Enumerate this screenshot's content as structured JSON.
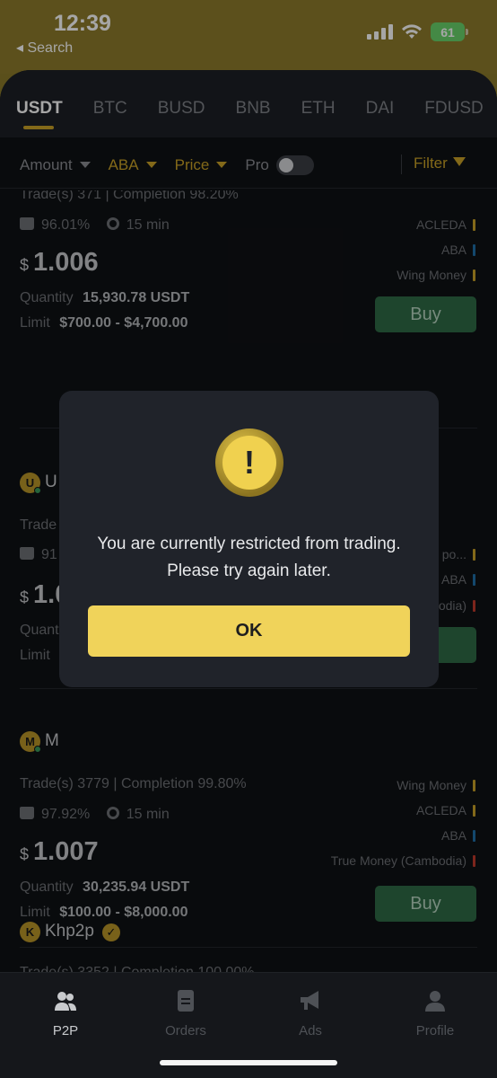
{
  "status_bar": {
    "time": "12:39",
    "back_label": "◂ Search",
    "battery": "61"
  },
  "tabs": [
    "USDT",
    "BTC",
    "BUSD",
    "BNB",
    "ETH",
    "DAI",
    "FDUSD"
  ],
  "filters": {
    "amount": "Amount",
    "bank": "ABA",
    "price": "Price",
    "pro": "Pro",
    "filter": "Filter"
  },
  "cards": [
    {
      "stats": "Trade(s) 371 | Completion 98.20%",
      "positive_rate": "96.01%",
      "time_limit": "15 min",
      "currency": "$",
      "price": "1.006",
      "quantity_label": "Quantity",
      "quantity": "15,930.78 USDT",
      "limit_label": "Limit",
      "limit": "$700.00 - $4,700.00",
      "payments": [
        {
          "name": "ACLEDA",
          "color": "#c9a227"
        },
        {
          "name": "ABA",
          "color": "#1e6fa8"
        },
        {
          "name": "Wing Money",
          "color": "#c9a227"
        }
      ],
      "buy": "Buy"
    },
    {
      "merchant_initial": "U",
      "merchant_partial": "U",
      "stats_partial": "Trade",
      "rate_partial": "91",
      "price_partial": "1.0",
      "quantity_partial": "Quant",
      "limit_partial": "Limit",
      "payments_partial": [
        "po...",
        "ABA",
        "odia)"
      ]
    },
    {
      "merchant_initial": "M",
      "merchant_partial": "M",
      "stats": "Trade(s) 3779 | Completion 99.80%",
      "positive_rate": "97.92%",
      "time_limit": "15 min",
      "currency": "$",
      "price": "1.007",
      "quantity_label": "Quantity",
      "quantity": "30,235.94 USDT",
      "limit_label": "Limit",
      "limit": "$100.00 - $8,000.00",
      "payments": [
        {
          "name": "Wing Money",
          "color": "#c9a227"
        },
        {
          "name": "ACLEDA",
          "color": "#c9a227"
        },
        {
          "name": "ABA",
          "color": "#1e6fa8"
        },
        {
          "name": "True Money (Cambodia)",
          "color": "#c0392b"
        }
      ],
      "buy": "Buy"
    },
    {
      "merchant_initial": "K",
      "merchant": "Khp2p",
      "stats_partial": "Trade(s) 3352 | Completion 100.00%"
    }
  ],
  "modal": {
    "icon": "!",
    "message": "You are currently restricted from trading. Please try again later.",
    "ok": "OK"
  },
  "bottom_nav": [
    "P2P",
    "Orders",
    "Ads",
    "Profile"
  ]
}
